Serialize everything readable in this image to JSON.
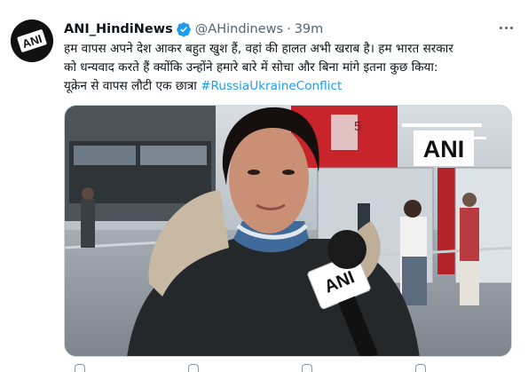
{
  "tweet": {
    "author_name": "ANI_HindiNews",
    "handle": "@AHindinews",
    "separator": "·",
    "time": "39m",
    "text_lines": [
      "हम वापस अपने देश आकर बहुत खुश हैं, वहां की हालत अभी खराब है। हम भारत सरकार",
      "को धन्यवाद करते हैं क्योंकि उन्होंने हमारे बारे में सोचा और बिना मांगे इतना कुछ किया:",
      "यूक्रेन से वापस लौटी एक छात्रा"
    ],
    "hashtag": "#RussiaUkraineConflict",
    "avatar_logo_text": "ANI",
    "media": {
      "watermark": "ANI",
      "mic_logo": "ANI",
      "sign_number": "5"
    }
  },
  "colors": {
    "link": "#1d9bf0",
    "verified": "#1d9bf0",
    "muted_text": "#536471",
    "primary_text": "#0f1419"
  },
  "icons": {
    "verified": "verified-badge-icon",
    "more": "more-options-icon"
  }
}
